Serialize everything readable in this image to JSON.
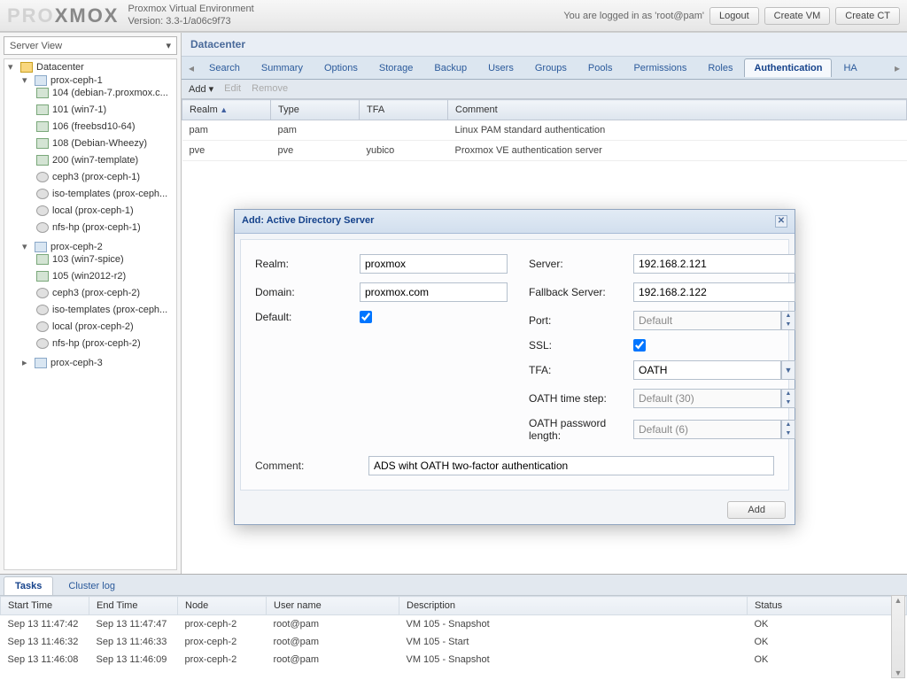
{
  "header": {
    "logo_a": "PRO",
    "logo_b": "XMOX",
    "title": "Proxmox Virtual Environment",
    "version": "Version: 3.3-1/a06c9f73",
    "login_msg": "You are logged in as 'root@pam'",
    "logout": "Logout",
    "create_vm": "Create VM",
    "create_ct": "Create CT"
  },
  "sidebar": {
    "view": "Server View",
    "root": "Datacenter",
    "nodes": [
      {
        "name": "prox-ceph-1",
        "children": [
          {
            "t": "vm",
            "label": "104 (debian-7.proxmox.c..."
          },
          {
            "t": "vm",
            "label": "101 (win7-1)"
          },
          {
            "t": "vm",
            "label": "106 (freebsd10-64)"
          },
          {
            "t": "vm",
            "label": "108 (Debian-Wheezy)"
          },
          {
            "t": "vm",
            "label": "200 (win7-template)"
          },
          {
            "t": "disk",
            "label": "ceph3 (prox-ceph-1)"
          },
          {
            "t": "disk",
            "label": "iso-templates (prox-ceph..."
          },
          {
            "t": "disk",
            "label": "local (prox-ceph-1)"
          },
          {
            "t": "disk",
            "label": "nfs-hp (prox-ceph-1)"
          }
        ]
      },
      {
        "name": "prox-ceph-2",
        "children": [
          {
            "t": "vm",
            "label": "103 (win7-spice)"
          },
          {
            "t": "vm",
            "label": "105 (win2012-r2)"
          },
          {
            "t": "disk",
            "label": "ceph3 (prox-ceph-2)"
          },
          {
            "t": "disk",
            "label": "iso-templates (prox-ceph..."
          },
          {
            "t": "disk",
            "label": "local (prox-ceph-2)"
          },
          {
            "t": "disk",
            "label": "nfs-hp (prox-ceph-2)"
          }
        ]
      },
      {
        "name": "prox-ceph-3",
        "children": []
      }
    ]
  },
  "content": {
    "crumb": "Datacenter",
    "tabs": [
      "Search",
      "Summary",
      "Options",
      "Storage",
      "Backup",
      "Users",
      "Groups",
      "Pools",
      "Permissions",
      "Roles",
      "Authentication",
      "HA"
    ],
    "active_tab": "Authentication",
    "toolbar": {
      "add": "Add",
      "edit": "Edit",
      "remove": "Remove"
    },
    "cols": {
      "realm": "Realm",
      "type": "Type",
      "tfa": "TFA",
      "comment": "Comment"
    },
    "rows": [
      {
        "realm": "pam",
        "type": "pam",
        "tfa": "",
        "comment": "Linux PAM standard authentication"
      },
      {
        "realm": "pve",
        "type": "pve",
        "tfa": "yubico",
        "comment": "Proxmox VE authentication server"
      }
    ]
  },
  "log": {
    "tabs": {
      "tasks": "Tasks",
      "cluster": "Cluster log"
    },
    "cols": {
      "start": "Start Time",
      "end": "End Time",
      "node": "Node",
      "user": "User name",
      "desc": "Description",
      "status": "Status"
    },
    "rows": [
      {
        "start": "Sep 13 11:47:42",
        "end": "Sep 13 11:47:47",
        "node": "prox-ceph-2",
        "user": "root@pam",
        "desc": "VM 105 - Snapshot",
        "status": "OK"
      },
      {
        "start": "Sep 13 11:46:32",
        "end": "Sep 13 11:46:33",
        "node": "prox-ceph-2",
        "user": "root@pam",
        "desc": "VM 105 - Start",
        "status": "OK"
      },
      {
        "start": "Sep 13 11:46:08",
        "end": "Sep 13 11:46:09",
        "node": "prox-ceph-2",
        "user": "root@pam",
        "desc": "VM 105 - Snapshot",
        "status": "OK"
      }
    ]
  },
  "modal": {
    "title": "Add: Active Directory Server",
    "labels": {
      "realm": "Realm:",
      "domain": "Domain:",
      "default": "Default:",
      "server": "Server:",
      "fallback": "Fallback Server:",
      "port": "Port:",
      "ssl": "SSL:",
      "tfa": "TFA:",
      "oath_step": "OATH time step:",
      "oath_len": "OATH password length:",
      "comment": "Comment:"
    },
    "values": {
      "realm": "proxmox",
      "domain": "proxmox.com",
      "default": true,
      "server": "192.168.2.121",
      "fallback": "192.168.2.122",
      "port": "Default",
      "ssl": true,
      "tfa": "OATH",
      "oath_step": "Default (30)",
      "oath_len": "Default (6)",
      "comment": "ADS wiht OATH two-factor authentication"
    },
    "add_btn": "Add"
  }
}
